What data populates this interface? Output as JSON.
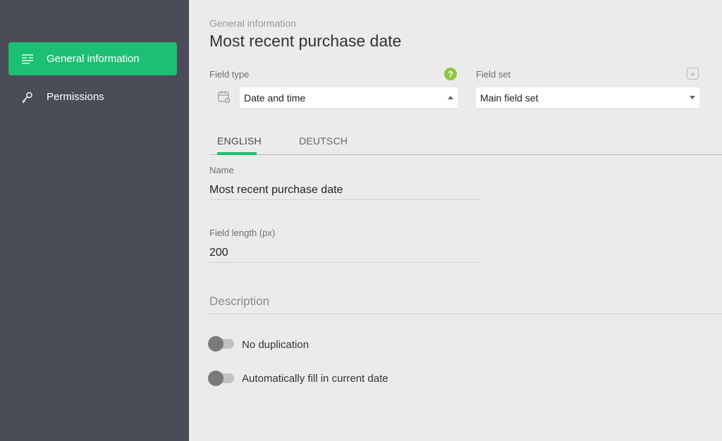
{
  "sidebar": {
    "items": [
      {
        "label": "General information",
        "icon": "list-icon",
        "active": true
      },
      {
        "label": "Permissions",
        "icon": "key-icon",
        "active": false
      }
    ]
  },
  "header": {
    "breadcrumb": "General information",
    "title": "Most recent purchase date"
  },
  "field_type": {
    "label": "Field type",
    "value": "Date and time",
    "help_icon": "question-icon",
    "icon": "calendar-icon"
  },
  "field_set": {
    "label": "Field set",
    "value": "Main field set",
    "action_icon": "add-icon"
  },
  "tabs": [
    {
      "label": "ENGLISH",
      "active": true
    },
    {
      "label": "DEUTSCH",
      "active": false
    }
  ],
  "name_field": {
    "label": "Name",
    "value": "Most recent purchase date"
  },
  "length_field": {
    "label": "Field length (px)",
    "value": "200"
  },
  "description": {
    "label": "Description"
  },
  "toggles": [
    {
      "label": "No duplication",
      "on": false
    },
    {
      "label": "Automatically fill in current date",
      "on": false
    }
  ],
  "colors": {
    "accent": "#1dbf73",
    "sidebar": "#4a4c58",
    "background": "#ebebeb",
    "help": "#8dc63f"
  }
}
